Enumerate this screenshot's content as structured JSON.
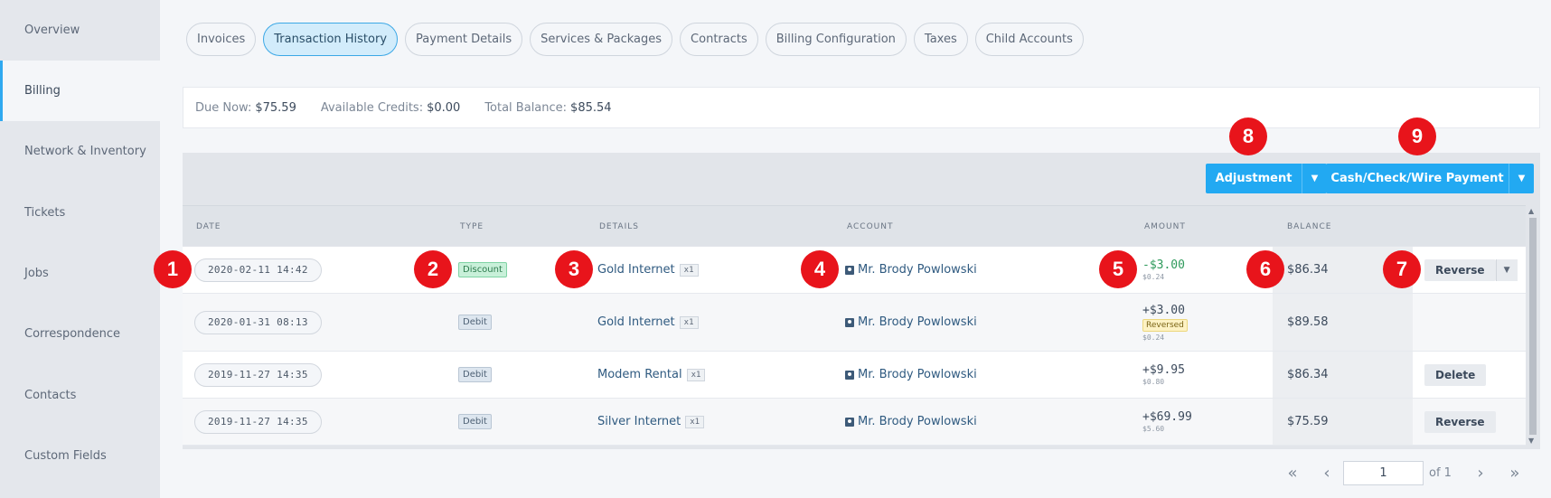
{
  "sidebar": {
    "items": [
      {
        "label": "Overview"
      },
      {
        "label": "Billing"
      },
      {
        "label": "Network & Inventory"
      },
      {
        "label": "Tickets"
      },
      {
        "label": "Jobs"
      },
      {
        "label": "Correspondence"
      },
      {
        "label": "Contacts"
      },
      {
        "label": "Custom Fields"
      }
    ],
    "active": "Billing"
  },
  "tabs": [
    {
      "label": "Invoices"
    },
    {
      "label": "Transaction History"
    },
    {
      "label": "Payment Details"
    },
    {
      "label": "Services & Packages"
    },
    {
      "label": "Contracts"
    },
    {
      "label": "Billing Configuration"
    },
    {
      "label": "Taxes"
    },
    {
      "label": "Child Accounts"
    }
  ],
  "summary": {
    "due_now_label": "Due Now:",
    "due_now": "$75.59",
    "credits_label": "Available Credits:",
    "credits": "$0.00",
    "balance_label": "Total Balance:",
    "balance": "$85.54"
  },
  "actions": {
    "adjustment": "Adjustment",
    "payment": "Cash/Check/Wire Payment"
  },
  "table": {
    "headers": {
      "date": "DATE",
      "type": "TYPE",
      "details": "DETAILS",
      "account": "ACCOUNT",
      "amount": "AMOUNT",
      "balance": "BALANCE"
    },
    "rows": [
      {
        "date": "2020-02-11 14:42",
        "type": "Discount",
        "detail": "Gold Internet",
        "qty": "x1",
        "account": "Mr. Brody Powlowski",
        "amount": "-$3.00",
        "tax": "$0.24",
        "balance": "$86.34",
        "action": "Reverse"
      },
      {
        "date": "2020-01-31 08:13",
        "type": "Debit",
        "detail": "Gold Internet",
        "qty": "x1",
        "account": "Mr. Brody Powlowski",
        "amount": "+$3.00",
        "status": "Reversed",
        "tax": "$0.24",
        "balance": "$89.58"
      },
      {
        "date": "2019-11-27 14:35",
        "type": "Debit",
        "detail": "Modem Rental",
        "qty": "x1",
        "account": "Mr. Brody Powlowski",
        "amount": "+$9.95",
        "tax": "$0.80",
        "balance": "$86.34",
        "action": "Delete"
      },
      {
        "date": "2019-11-27 14:35",
        "type": "Debit",
        "detail": "Silver Internet",
        "qty": "x1",
        "account": "Mr. Brody Powlowski",
        "amount": "+$69.99",
        "tax": "$5.60",
        "balance": "$75.59",
        "action": "Reverse"
      }
    ]
  },
  "pagination": {
    "page": "1",
    "of": "of 1"
  },
  "markers": [
    "1",
    "2",
    "3",
    "4",
    "5",
    "6",
    "7",
    "8",
    "9"
  ],
  "colors": {
    "accent": "#22a9f2",
    "marker": "#e8141b",
    "positive": "#2f9a5c"
  }
}
